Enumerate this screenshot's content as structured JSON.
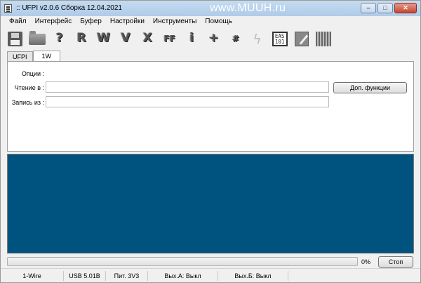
{
  "window": {
    "title": ":: UFPI v2.0.6 Сборка 12.04.2021",
    "watermark": "www.MUUH.ru",
    "controls": {
      "minimize": "–",
      "maximize": "□",
      "close": "✕"
    }
  },
  "menu": [
    "Файл",
    "Интерфейс",
    "Буфер",
    "Настройки",
    "Инструменты",
    "Помощь"
  ],
  "toolbar": [
    {
      "name": "save-icon",
      "glyph": ""
    },
    {
      "name": "open-folder-icon",
      "glyph": ""
    },
    {
      "name": "question-icon",
      "glyph": "?"
    },
    {
      "name": "read-icon",
      "glyph": "R"
    },
    {
      "name": "write-icon",
      "glyph": "W"
    },
    {
      "name": "verify-icon",
      "glyph": "V"
    },
    {
      "name": "erase-icon",
      "glyph": "X"
    },
    {
      "name": "ff-icon",
      "glyph": "FF"
    },
    {
      "name": "info-icon",
      "glyph": "i"
    },
    {
      "name": "plus-icon",
      "glyph": "+"
    },
    {
      "name": "hash-icon",
      "glyph": "#"
    },
    {
      "name": "lightning-icon",
      "glyph": ""
    },
    {
      "name": "eas101-icon",
      "glyph": "EAS 101"
    },
    {
      "name": "edit-icon",
      "glyph": ""
    },
    {
      "name": "hex-grid-icon",
      "glyph": ""
    }
  ],
  "tabs": [
    {
      "label": "UFPI",
      "active": false
    },
    {
      "label": "1W",
      "active": true
    }
  ],
  "form": {
    "options_label": "Опции :",
    "read_label": "Чтение в :",
    "read_value": "",
    "write_label": "Запись из :",
    "write_value": "",
    "extra_button": "Доп. функции"
  },
  "progress": {
    "value": 0,
    "label": "0%"
  },
  "stop_button": "Стоп",
  "status": [
    "1-Wire",
    "USB 5.01B",
    "Пит. 3V3",
    "Вых.А: Выкл",
    "Вых.Б: Выкл"
  ],
  "colors": {
    "log_bg": "#00537f",
    "titlebar": "#bcd4ee"
  }
}
